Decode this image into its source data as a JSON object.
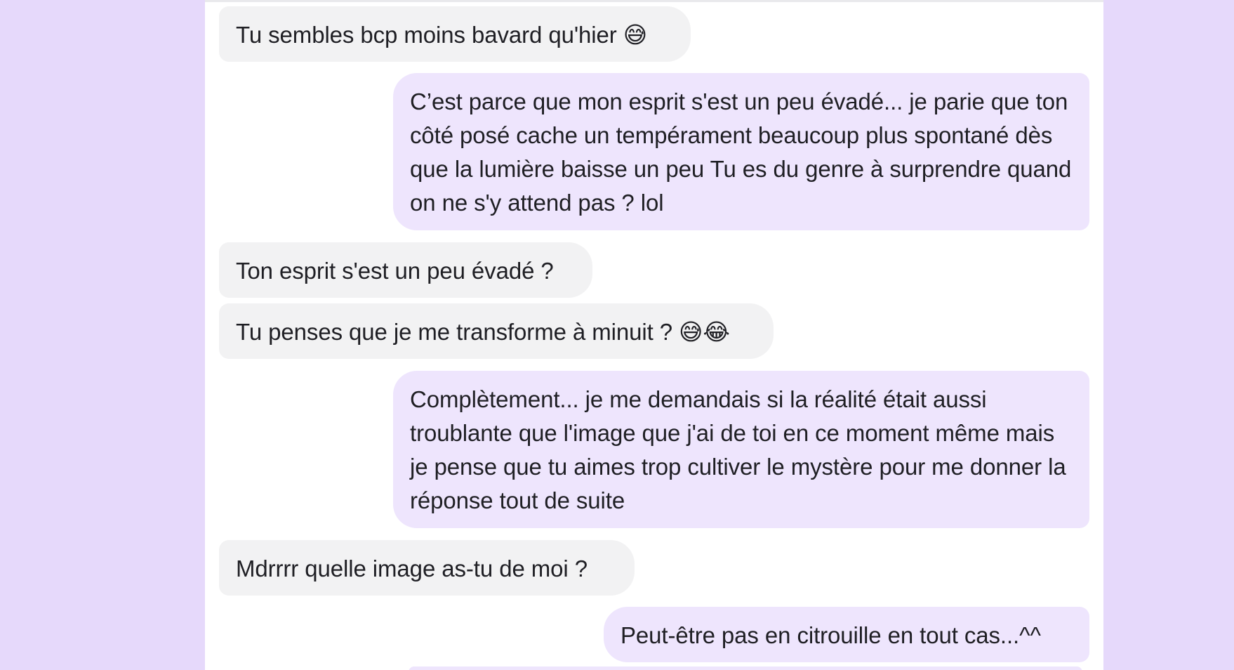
{
  "messages": [
    {
      "id": "m1",
      "from": "them",
      "text": "Tu sembles bcp moins bavard qu'hier 😅"
    },
    {
      "id": "m2",
      "from": "me",
      "text": "C’est parce que mon esprit s'est un peu évadé... je parie que ton côté posé cache un tempérament beaucoup plus spontané dès que la lumière baisse un peu Tu es du genre à surprendre quand on ne s'y attend pas ? lol"
    },
    {
      "id": "m3",
      "from": "them",
      "text": "Ton esprit s'est un peu évadé ?"
    },
    {
      "id": "m4",
      "from": "them",
      "text": "Tu penses que je me transforme à minuit ? 😅😂"
    },
    {
      "id": "m5",
      "from": "me",
      "text": "Complètement... je me demandais si la réalité était aussi troublante que l'image que j'ai de toi en ce moment même mais je pense que tu aimes trop cultiver le mystère pour me donner la réponse tout de suite"
    },
    {
      "id": "m6",
      "from": "them",
      "text": "Mdrrrr quelle image as-tu de moi ?"
    },
    {
      "id": "m7",
      "from": "me",
      "text": "Peut-être pas en citrouille en tout cas...^^"
    }
  ],
  "colors": {
    "page_background": "#e6d9fb",
    "panel_background": "#ffffff",
    "incoming_bubble": "#f2f2f3",
    "outgoing_bubble": "#eee5fd",
    "text": "#1f1f24"
  }
}
